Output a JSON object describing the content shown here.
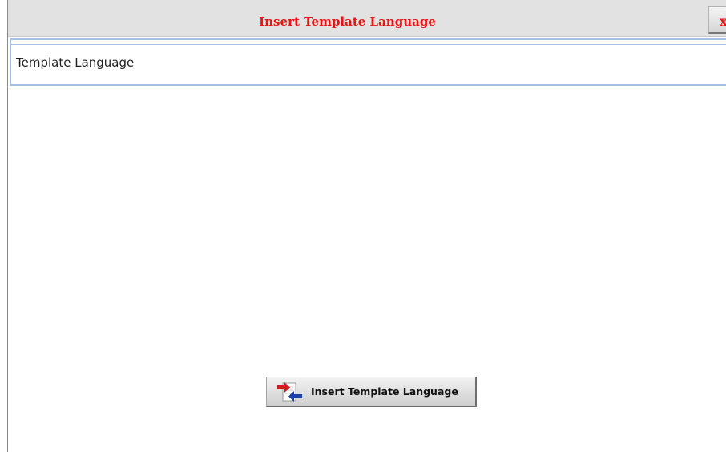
{
  "dialog": {
    "title": "Insert Template Language",
    "close_label": "x"
  },
  "field": {
    "value": "Template Language"
  },
  "insert_button": {
    "label": "Insert Template Language",
    "icon": "insert-swap-icon"
  },
  "colors": {
    "title": "#ee1111",
    "titlebar_bg": "#e2e2e2",
    "field_border": "#a8bfe4"
  }
}
